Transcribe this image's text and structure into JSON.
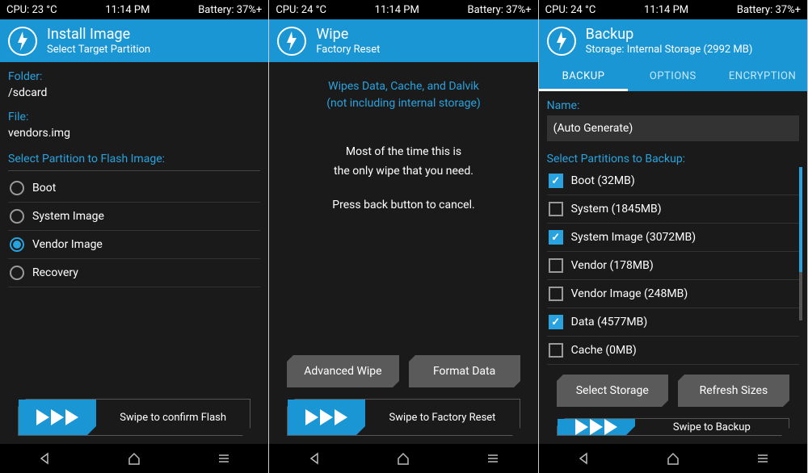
{
  "screens": [
    {
      "status": {
        "cpu": "CPU: 23 °C",
        "time": "11:14 PM",
        "battery": "Battery: 37%+"
      },
      "header": {
        "title": "Install Image",
        "sub": "Select Target Partition"
      },
      "folder_label": "Folder:",
      "folder_value": "/sdcard",
      "file_label": "File:",
      "file_value": "vendors.img",
      "partition_label": "Select Partition to Flash Image:",
      "partitions": [
        {
          "label": "Boot",
          "selected": false
        },
        {
          "label": "System Image",
          "selected": false
        },
        {
          "label": "Vendor Image",
          "selected": true
        },
        {
          "label": "Recovery",
          "selected": false
        }
      ],
      "swipe_label": "Swipe to confirm Flash"
    },
    {
      "status": {
        "cpu": "CPU: 24 °C",
        "time": "11:14 PM",
        "battery": "Battery: 37%+"
      },
      "header": {
        "title": "Wipe",
        "sub": "Factory Reset"
      },
      "msg_blue_1": "Wipes Data, Cache, and Dalvik",
      "msg_blue_2": "(not including internal storage)",
      "msg_white_1": "Most of the time this is",
      "msg_white_2": "the only wipe that you need.",
      "msg_white_3": "Press back button to cancel.",
      "btn_left": "Advanced Wipe",
      "btn_right": "Format Data",
      "swipe_label": "Swipe to Factory Reset"
    },
    {
      "status": {
        "cpu": "CPU: 24 °C",
        "time": "11:14 PM",
        "battery": "Battery: 37%+"
      },
      "header": {
        "title": "Backup",
        "sub": "Storage: Internal Storage (2992 MB)"
      },
      "tabs": [
        {
          "label": "BACKUP",
          "active": true
        },
        {
          "label": "OPTIONS",
          "active": false
        },
        {
          "label": "ENCRYPTION",
          "active": false
        }
      ],
      "name_label": "Name:",
      "name_value": "(Auto Generate)",
      "partitions_label": "Select Partitions to Backup:",
      "partitions": [
        {
          "label": "Boot (32MB)",
          "selected": true
        },
        {
          "label": "System (1845MB)",
          "selected": false
        },
        {
          "label": "System Image (3072MB)",
          "selected": true
        },
        {
          "label": "Vendor (178MB)",
          "selected": false
        },
        {
          "label": "Vendor Image (248MB)",
          "selected": false
        },
        {
          "label": "Data (4577MB)",
          "selected": true
        },
        {
          "label": "Cache (0MB)",
          "selected": false
        }
      ],
      "btn_left": "Select Storage",
      "btn_right": "Refresh Sizes",
      "swipe_label": "Swipe to Backup"
    }
  ]
}
